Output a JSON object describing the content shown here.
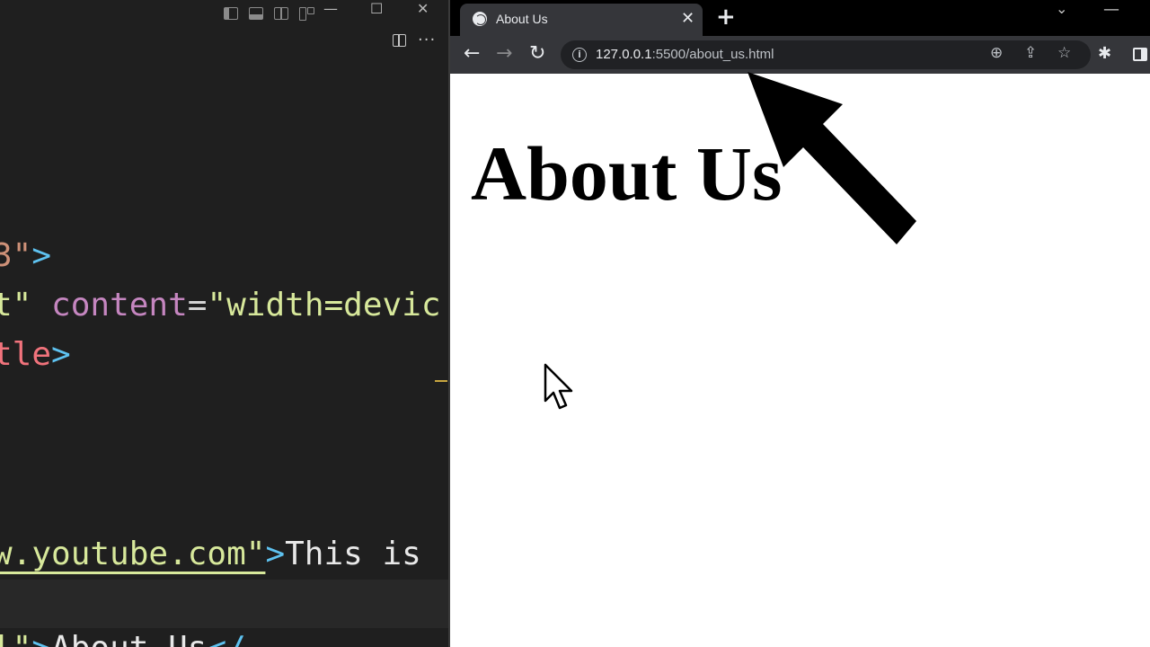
{
  "editor": {
    "more_label": "···",
    "window_controls": {
      "minimize": "—",
      "maximize": "☐",
      "close": "✕"
    },
    "code_lines": [
      {
        "parts": [
          "3\"",
          ">"
        ]
      },
      {
        "parts": [
          "t\"",
          " ",
          "content",
          "=",
          "\"width=devic"
        ]
      },
      {
        "parts": [
          "tle",
          ">"
        ]
      },
      {
        "parts": [
          "w.youtube.com\"",
          ">",
          "This is"
        ]
      },
      {
        "parts": [
          "l\"",
          ">",
          "About Us",
          "</"
        ]
      }
    ]
  },
  "browser": {
    "tab": {
      "title": "About Us",
      "close": "✕",
      "favicon": "globe-icon"
    },
    "new_tab": "+",
    "tab_search": "⌄",
    "minimize": "—",
    "nav": {
      "back": "←",
      "forward": "→",
      "reload": "↻"
    },
    "address": {
      "host": "127.0.0.1",
      "rest": ":5500/about_us.html",
      "info": "i"
    },
    "omnibox_icons": {
      "zoom": "⊕",
      "share": "⇪",
      "bookmark": "☆"
    },
    "extensions": "✱",
    "page": {
      "heading": "About Us"
    }
  },
  "colors": {
    "editor_bg": "#1f1f1f",
    "string": "#ce9178",
    "attr_value": "#d7e89b",
    "tag_bracket": "#5ec2f0",
    "attribute": "#c586c0",
    "tag_name": "#f1737c",
    "browser_toolbar": "#35363a",
    "omnibox": "#202124"
  }
}
